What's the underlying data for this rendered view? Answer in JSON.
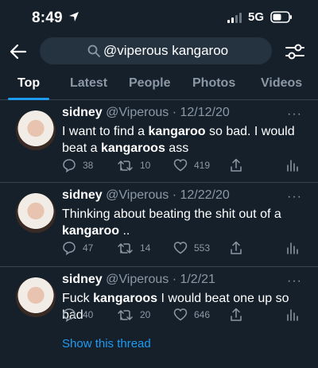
{
  "status_bar": {
    "time": "8:49",
    "network": "5G"
  },
  "search": {
    "query": "@viperous kangaroo"
  },
  "tabs": [
    {
      "label": "Top",
      "active": true
    },
    {
      "label": "Latest",
      "active": false
    },
    {
      "label": "People",
      "active": false
    },
    {
      "label": "Photos",
      "active": false
    },
    {
      "label": "Videos",
      "active": false
    }
  ],
  "tweets": [
    {
      "name": "sidney",
      "handle_date": "@Viperous · 12/12/20",
      "text_parts": [
        "I want to find a ",
        "kangaroo",
        " so bad. I would beat a ",
        "kangaroos",
        " ass"
      ],
      "replies": "38",
      "retweets": "10",
      "likes": "419"
    },
    {
      "name": "sidney",
      "handle_date": "@Viperous · 12/22/20",
      "text_parts": [
        "Thinking about beating the shit out of a ",
        "kangaroo",
        " .."
      ],
      "replies": "47",
      "retweets": "14",
      "likes": "553"
    },
    {
      "name": "sidney",
      "handle_date": "@Viperous · 1/2/21",
      "text_parts": [
        "Fuck ",
        "kangaroos",
        " I would beat one up so bad"
      ],
      "replies": "40",
      "retweets": "20",
      "likes": "646"
    }
  ],
  "show_thread": "Show this thread",
  "colors": {
    "background": "#15202b",
    "accent": "#1d9bf0",
    "muted": "#8b98a5"
  }
}
